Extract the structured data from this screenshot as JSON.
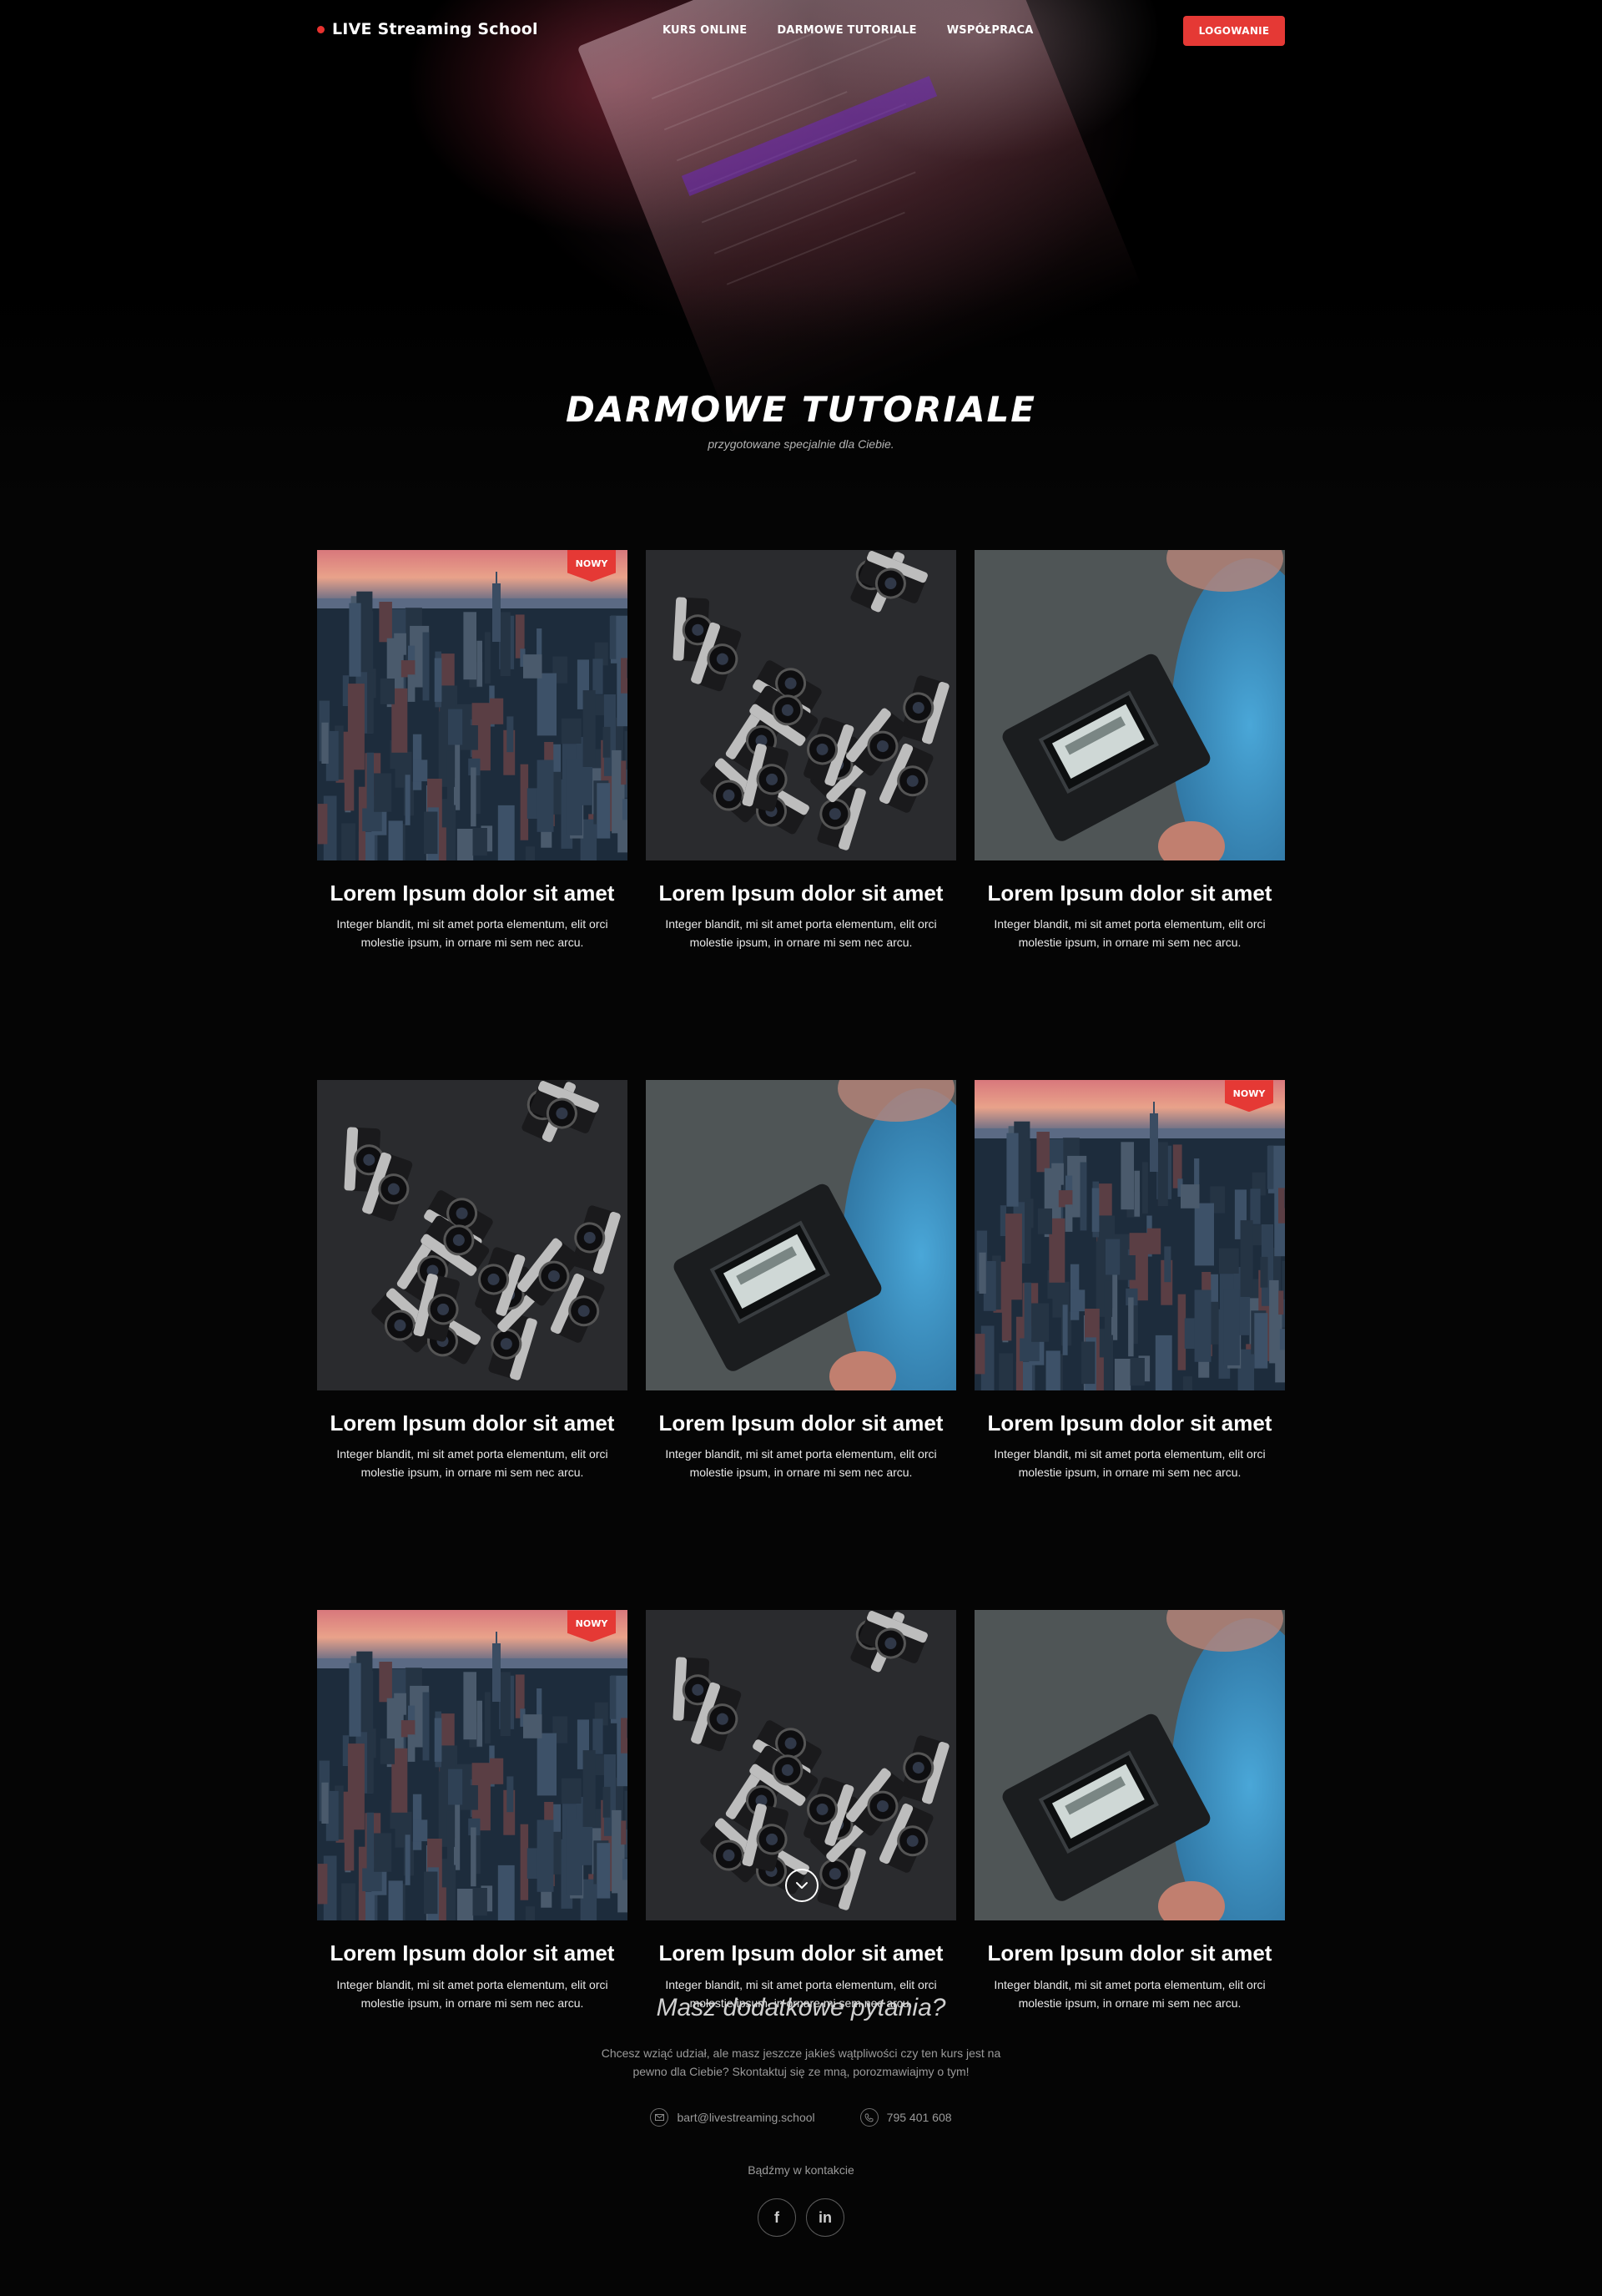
{
  "header": {
    "brand": "LIVE Streaming School",
    "nav": [
      {
        "label": "KURS ONLINE"
      },
      {
        "label": "DARMOWE TUTORIALE"
      },
      {
        "label": "WSPÓŁPRACA"
      }
    ],
    "login_label": "LOGOWANIE"
  },
  "hero": {
    "title": "DARMOWE TUTORIALE",
    "subtitle": "przygotowane specjalnie dla Ciebie."
  },
  "cards": [
    {
      "image": "city-skyline",
      "badge": "NOWY",
      "title": "Lorem Ipsum dolor sit amet",
      "text": "Integer blandit, mi sit amet porta elementum, elit orci molestie ipsum, in ornare mi sem nec arcu."
    },
    {
      "image": "cameras",
      "badge": "",
      "title": "Lorem Ipsum dolor sit amet",
      "text": "Integer blandit, mi sit amet porta elementum, elit orci molestie ipsum, in ornare mi sem nec arcu."
    },
    {
      "image": "videographer",
      "badge": "",
      "title": "Lorem Ipsum dolor sit amet",
      "text": "Integer blandit, mi sit amet porta elementum, elit orci molestie ipsum, in ornare mi sem nec arcu."
    },
    {
      "image": "cameras",
      "badge": "",
      "title": "Lorem Ipsum dolor sit amet",
      "text": "Integer blandit, mi sit amet porta elementum, elit orci molestie ipsum, in ornare mi sem nec arcu."
    },
    {
      "image": "videographer",
      "badge": "",
      "title": "Lorem Ipsum dolor sit amet",
      "text": "Integer blandit, mi sit amet porta elementum, elit orci molestie ipsum, in ornare mi sem nec arcu."
    },
    {
      "image": "city-skyline",
      "badge": "NOWY",
      "title": "Lorem Ipsum dolor sit amet",
      "text": "Integer blandit, mi sit amet porta elementum, elit orci molestie ipsum, in ornare mi sem nec arcu."
    },
    {
      "image": "city-skyline",
      "badge": "NOWY",
      "title": "Lorem Ipsum dolor sit amet",
      "text": "Integer blandit, mi sit amet porta elementum, elit orci molestie ipsum, in ornare mi sem nec arcu."
    },
    {
      "image": "cameras",
      "badge": "",
      "title": "Lorem Ipsum dolor sit amet",
      "text": "Integer blandit, mi sit amet porta elementum, elit orci molestie ipsum, in ornare mi sem nec arcu."
    },
    {
      "image": "videographer",
      "badge": "",
      "title": "Lorem Ipsum dolor sit amet",
      "text": "Integer blandit, mi sit amet porta elementum, elit orci molestie ipsum, in ornare mi sem nec arcu."
    }
  ],
  "more": {
    "icon": "chevron-down-icon"
  },
  "contact": {
    "title": "Masz dodatkowe pytania?",
    "text": "Chcesz wziąć udział, ale masz jeszcze jakieś wątpliwości czy ten kurs jest na pewno dla Ciebie? Skontaktuj się ze mną, porozmawiajmy o tym!",
    "email": "bart@livestreaming.school",
    "phone": "795 401 608",
    "social_label": "Bądźmy w kontakcie",
    "social": [
      {
        "icon": "facebook-icon",
        "glyph": "f"
      },
      {
        "icon": "linkedin-icon",
        "glyph": "in"
      }
    ]
  },
  "colors": {
    "accent": "#e53935",
    "background": "#050505"
  }
}
